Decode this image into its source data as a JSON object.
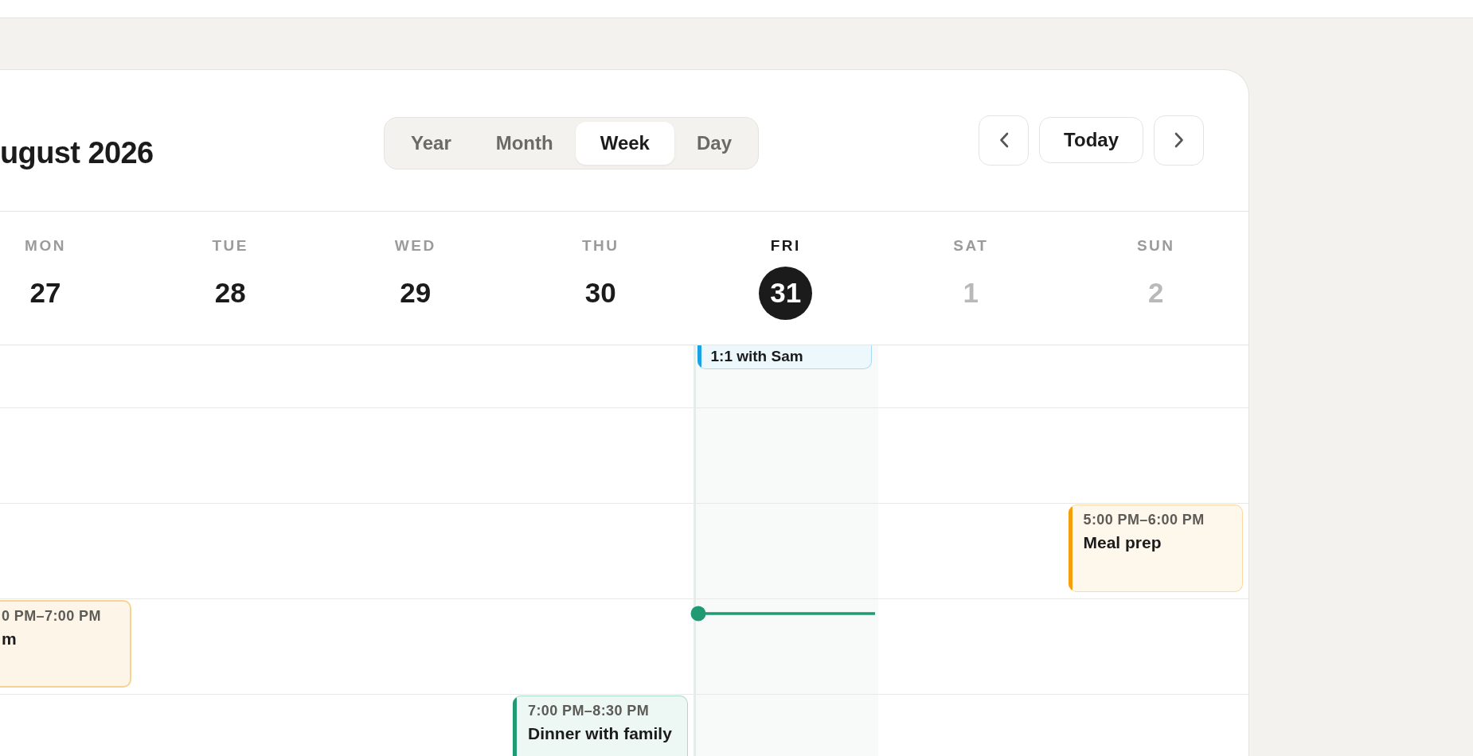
{
  "header": {
    "title": "ugust 2026",
    "views": [
      {
        "label": "Year",
        "selected": false
      },
      {
        "label": "Month",
        "selected": false
      },
      {
        "label": "Week",
        "selected": true
      },
      {
        "label": "Day",
        "selected": false
      }
    ],
    "today_button": "Today"
  },
  "days": [
    {
      "weekday": "MON",
      "date": "27",
      "today": false,
      "other_month": false
    },
    {
      "weekday": "TUE",
      "date": "28",
      "today": false,
      "other_month": false
    },
    {
      "weekday": "WED",
      "date": "29",
      "today": false,
      "other_month": false
    },
    {
      "weekday": "THU",
      "date": "30",
      "today": false,
      "other_month": false
    },
    {
      "weekday": "FRI",
      "date": "31",
      "today": true,
      "other_month": false
    },
    {
      "weekday": "SAT",
      "date": "1",
      "today": false,
      "other_month": true
    },
    {
      "weekday": "SUN",
      "date": "2",
      "today": false,
      "other_month": true
    }
  ],
  "schedule": {
    "rows": [
      [
        null,
        null,
        null,
        null,
        {
          "kind": "event-end",
          "title": "1:1 with Sam",
          "color": "#1aa2e6"
        },
        null,
        null
      ],
      [
        null,
        null,
        null,
        null,
        null,
        null,
        null
      ],
      [
        null,
        null,
        null,
        null,
        null,
        null,
        {
          "kind": "event",
          "time": "5:00 PM–6:00 PM",
          "title": "Meal prep",
          "color": "#f59e0b"
        }
      ],
      [
        {
          "kind": "event-cut",
          "time": "0 PM–7:00 PM",
          "title": "m",
          "color": "#f6d394"
        },
        null,
        null,
        null,
        {
          "kind": "now"
        },
        null,
        null
      ],
      [
        null,
        null,
        null,
        {
          "kind": "event",
          "time": "7:00 PM–8:30 PM",
          "title": "Dinner with family",
          "color": "#1f9a72"
        },
        null,
        null,
        null
      ]
    ]
  }
}
